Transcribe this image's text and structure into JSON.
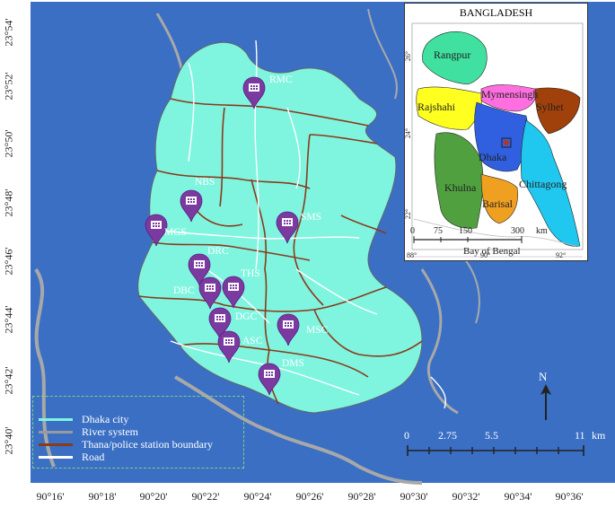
{
  "lat_labels": [
    "23°54'",
    "23°52'",
    "23°50'",
    "23°48'",
    "23°46'",
    "23°44'",
    "23°42'",
    "23°40'"
  ],
  "lon_labels": [
    "90°16'",
    "90°18'",
    "90°20'",
    "90°22'",
    "90°24'",
    "90°26'",
    "90°28'",
    "90°30'",
    "90°32'",
    "90°34'",
    "90°36'"
  ],
  "markers": [
    {
      "label": "RMC"
    },
    {
      "label": "NBS"
    },
    {
      "label": "MGS"
    },
    {
      "label": "SMS"
    },
    {
      "label": "DRC"
    },
    {
      "label": "THS"
    },
    {
      "label": "DBC"
    },
    {
      "label": "DGC"
    },
    {
      "label": "MSC"
    },
    {
      "label": "ASC"
    },
    {
      "label": "DMS"
    }
  ],
  "legend": [
    {
      "label": "Dhaka city",
      "color": "#7ff5e0"
    },
    {
      "label": "River system",
      "color": "#9a9a9a"
    },
    {
      "label": "Thana/police station boundary",
      "color": "#8b3a1a"
    },
    {
      "label": "Road",
      "color": "#ffffff"
    }
  ],
  "scale_bar": {
    "ticks": [
      "0",
      "2.75",
      "5.5",
      "11"
    ],
    "unit": "km"
  },
  "north_label": "N",
  "inset": {
    "title": "BANGLADESH",
    "regions": [
      {
        "label": "Rangpur",
        "color": "#3fe0a0"
      },
      {
        "label": "Mymensingh",
        "color": "#ff6fe0"
      },
      {
        "label": "Sylhet",
        "color": "#a0400a"
      },
      {
        "label": "Rajshahi",
        "color": "#ffff20"
      },
      {
        "label": "Dhaka",
        "color": "#3060e0"
      },
      {
        "label": "Khulna",
        "color": "#50a040"
      },
      {
        "label": "Chittagong",
        "color": "#20c8f0"
      },
      {
        "label": "Barisal",
        "color": "#f0a020"
      }
    ],
    "scale": {
      "ticks": [
        "0",
        "75",
        "150",
        "300"
      ],
      "unit": "km"
    },
    "sea_label": "Bay of Bengal",
    "lon_ticks": [
      "88°",
      "90°",
      "92°"
    ],
    "lat_ticks": [
      "26°",
      "24°",
      "22°"
    ]
  },
  "colors": {
    "water": "#3a6fc4",
    "city": "#7ff5e0",
    "boundary": "#8b3a1a",
    "marker": "#7a3aa0"
  }
}
